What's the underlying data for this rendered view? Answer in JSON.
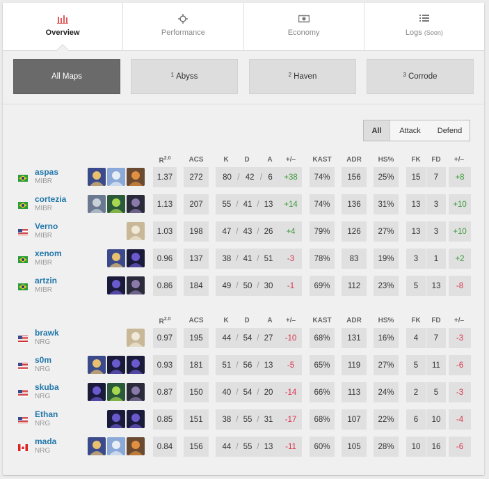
{
  "tabs": [
    {
      "label": "Overview",
      "icon": "bar-chart-icon",
      "active": true
    },
    {
      "label": "Performance",
      "icon": "crosshair-icon"
    },
    {
      "label": "Economy",
      "icon": "money-icon"
    },
    {
      "label": "Logs",
      "suffix": "(Soon)",
      "icon": "list-icon"
    }
  ],
  "maps": [
    {
      "num": "",
      "label": "All Maps",
      "active": true
    },
    {
      "num": "1",
      "label": "Abyss"
    },
    {
      "num": "2",
      "label": "Haven"
    },
    {
      "num": "3",
      "label": "Corrode"
    }
  ],
  "sides": [
    "All",
    "Attack",
    "Defend"
  ],
  "columns": {
    "rating": "R",
    "rating_sup": "2.0",
    "acs": "ACS",
    "k": "K",
    "d": "D",
    "a": "A",
    "kdiff": "+/–",
    "kast": "KAST",
    "adr": "ADR",
    "hs": "HS%",
    "fk": "FK",
    "fd": "FD",
    "fkdiff": "+/–"
  },
  "colors": {
    "positive": "#3c9a3c",
    "negative": "#d9334d",
    "link": "#2277aa"
  },
  "teams": [
    {
      "players": [
        {
          "name": "aspas",
          "team": "MIBR",
          "flag": "brazil",
          "agents": [
            "neon",
            "jett",
            "raze"
          ],
          "rating": "1.37",
          "acs": "272",
          "k": "80",
          "d": "42",
          "a": "6",
          "kdiff": "+38",
          "kast": "74%",
          "adr": "156",
          "hs": "25%",
          "fk": "15",
          "fd": "7",
          "fkdiff": "+8"
        },
        {
          "name": "cortezia",
          "team": "MIBR",
          "flag": "brazil",
          "agents": [
            "sova",
            "gekko",
            "fade"
          ],
          "rating": "1.13",
          "acs": "207",
          "k": "55",
          "d": "41",
          "a": "13",
          "kdiff": "+14",
          "kast": "74%",
          "adr": "136",
          "hs": "31%",
          "fk": "13",
          "fd": "3",
          "fkdiff": "+10"
        },
        {
          "name": "Verno",
          "team": "MIBR",
          "flag": "usa",
          "agents": [
            "cypher"
          ],
          "rating": "1.03",
          "acs": "198",
          "k": "47",
          "d": "43",
          "a": "26",
          "kdiff": "+4",
          "kast": "79%",
          "adr": "126",
          "hs": "27%",
          "fk": "13",
          "fd": "3",
          "fkdiff": "+10"
        },
        {
          "name": "xenom",
          "team": "MIBR",
          "flag": "brazil",
          "agents": [
            "neon",
            "omen"
          ],
          "rating": "0.96",
          "acs": "137",
          "k": "38",
          "d": "41",
          "a": "51",
          "kdiff": "-3",
          "kast": "78%",
          "adr": "83",
          "hs": "19%",
          "fk": "3",
          "fd": "1",
          "fkdiff": "+2"
        },
        {
          "name": "artzin",
          "team": "MIBR",
          "flag": "brazil",
          "agents": [
            "omen",
            "fade"
          ],
          "rating": "0.86",
          "acs": "184",
          "k": "49",
          "d": "50",
          "a": "30",
          "kdiff": "-1",
          "kast": "69%",
          "adr": "112",
          "hs": "23%",
          "fk": "5",
          "fd": "13",
          "fkdiff": "-8"
        }
      ]
    },
    {
      "players": [
        {
          "name": "brawk",
          "team": "NRG",
          "flag": "usa",
          "agents": [
            "cypher"
          ],
          "rating": "0.97",
          "acs": "195",
          "k": "44",
          "d": "54",
          "a": "27",
          "kdiff": "-10",
          "kast": "68%",
          "adr": "131",
          "hs": "16%",
          "fk": "4",
          "fd": "7",
          "fkdiff": "-3"
        },
        {
          "name": "s0m",
          "team": "NRG",
          "flag": "usa",
          "agents": [
            "neon",
            "omen",
            "omen"
          ],
          "rating": "0.93",
          "acs": "181",
          "k": "51",
          "d": "56",
          "a": "13",
          "kdiff": "-5",
          "kast": "65%",
          "adr": "119",
          "hs": "27%",
          "fk": "5",
          "fd": "11",
          "fkdiff": "-6"
        },
        {
          "name": "skuba",
          "team": "NRG",
          "flag": "usa",
          "agents": [
            "omen",
            "gekko",
            "fade"
          ],
          "rating": "0.87",
          "acs": "150",
          "k": "40",
          "d": "54",
          "a": "20",
          "kdiff": "-14",
          "kast": "66%",
          "adr": "113",
          "hs": "24%",
          "fk": "2",
          "fd": "5",
          "fkdiff": "-3"
        },
        {
          "name": "Ethan",
          "team": "NRG",
          "flag": "usa",
          "agents": [
            "omen",
            "omen"
          ],
          "rating": "0.85",
          "acs": "151",
          "k": "38",
          "d": "55",
          "a": "31",
          "kdiff": "-17",
          "kast": "68%",
          "adr": "107",
          "hs": "22%",
          "fk": "6",
          "fd": "10",
          "fkdiff": "-4"
        },
        {
          "name": "mada",
          "team": "NRG",
          "flag": "canada",
          "agents": [
            "neon",
            "jett",
            "raze"
          ],
          "rating": "0.84",
          "acs": "156",
          "k": "44",
          "d": "55",
          "a": "13",
          "kdiff": "-11",
          "kast": "60%",
          "adr": "105",
          "hs": "28%",
          "fk": "10",
          "fd": "16",
          "fkdiff": "-6"
        }
      ]
    }
  ]
}
